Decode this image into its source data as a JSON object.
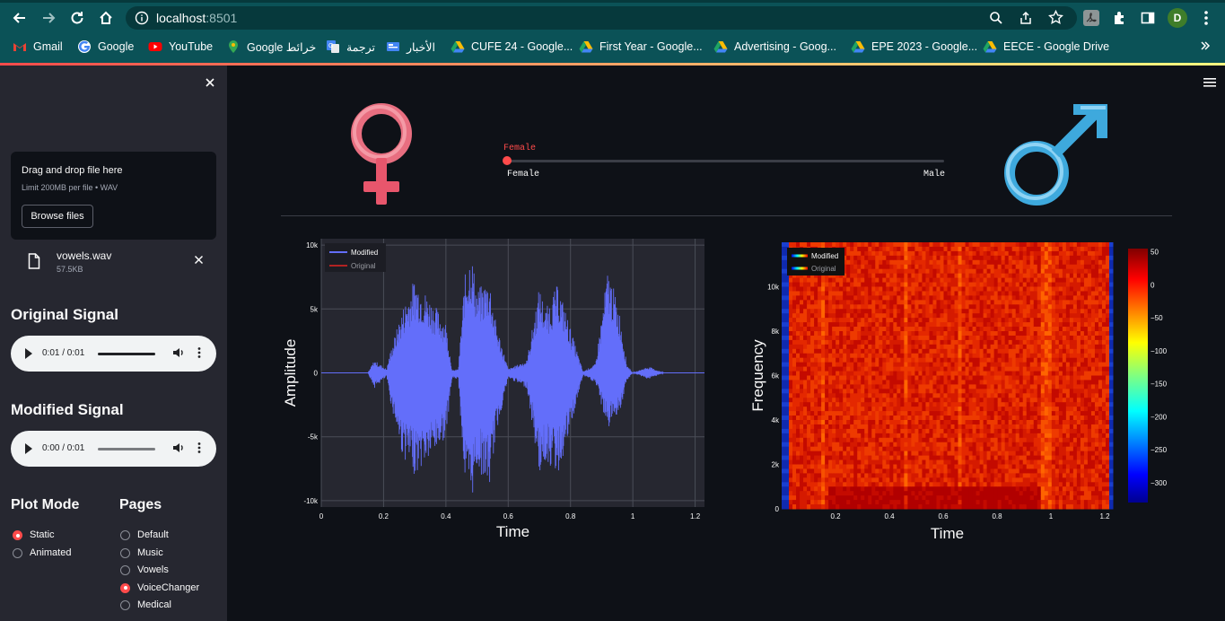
{
  "browser": {
    "url_host": "localhost",
    "url_port": ":8501",
    "bookmarks": [
      {
        "label": "Gmail",
        "icon": "gmail-icon",
        "color": "#ea4335"
      },
      {
        "label": "Google",
        "icon": "google-icon",
        "color": "#4285f4"
      },
      {
        "label": "YouTube",
        "icon": "youtube-icon",
        "color": "#ff0000"
      },
      {
        "label": "Google خرائط",
        "icon": "maps-icon",
        "color": "#34a853"
      },
      {
        "label": "ترجمة",
        "icon": "translate-icon",
        "color": "#4285f4"
      },
      {
        "label": "الأخبار",
        "icon": "news-icon",
        "color": "#4285f4"
      },
      {
        "label": "CUFE 24 - Google...",
        "icon": "drive-icon",
        "color": "#fbbc04"
      },
      {
        "label": "First Year  - Google...",
        "icon": "drive-icon",
        "color": "#fbbc04"
      },
      {
        "label": "Advertising  - Goog...",
        "icon": "drive-icon",
        "color": "#fbbc04"
      },
      {
        "label": "EPE 2023 - Google...",
        "icon": "drive-icon",
        "color": "#fbbc04"
      },
      {
        "label": "EECE - Google Drive",
        "icon": "drive-icon",
        "color": "#fbbc04"
      }
    ],
    "profile_initial": "D"
  },
  "sidebar": {
    "uploader": {
      "title": "Drag and drop file here",
      "limit": "Limit 200MB per file • WAV",
      "browse_label": "Browse files"
    },
    "file": {
      "name": "vowels.wav",
      "size": "57.5KB"
    },
    "original": {
      "heading": "Original Signal",
      "time": "0:01 / 0:01"
    },
    "modified": {
      "heading": "Modified Signal",
      "time": "0:00 / 0:01"
    },
    "plot_mode": {
      "heading": "Plot Mode",
      "options": [
        {
          "label": "Static",
          "selected": true
        },
        {
          "label": "Animated",
          "selected": false
        }
      ]
    },
    "pages": {
      "heading": "Pages",
      "options": [
        {
          "label": "Default",
          "selected": false
        },
        {
          "label": "Music",
          "selected": false
        },
        {
          "label": "Vowels",
          "selected": false
        },
        {
          "label": "VoiceChanger",
          "selected": true
        },
        {
          "label": "Medical",
          "selected": false
        }
      ]
    }
  },
  "voice_slider": {
    "current": "Female",
    "min_label": "Female",
    "max_label": "Male",
    "value": 0
  },
  "chart_data": [
    {
      "type": "line",
      "xlabel": "Time",
      "ylabel": "Amplitude",
      "xlim": [
        0,
        1.23
      ],
      "ylim": [
        -10500,
        10500
      ],
      "x_ticks": [
        "0",
        "0.2",
        "0.4",
        "0.6",
        "0.8",
        "1",
        "1.2"
      ],
      "y_ticks": [
        "10k",
        "5k",
        "0",
        "-5k",
        "-10k"
      ],
      "legend": [
        {
          "name": "Modified",
          "color": "#636efa"
        },
        {
          "name": "Original",
          "color": "#b22222"
        }
      ],
      "legend_position": "top-left",
      "series": [
        {
          "name": "Modified",
          "envelope_time": [
            0,
            0.15,
            0.17,
            0.21,
            0.22,
            0.26,
            0.3,
            0.36,
            0.4,
            0.42,
            0.44,
            0.46,
            0.48,
            0.5,
            0.54,
            0.56,
            0.6,
            0.66,
            0.7,
            0.72,
            0.76,
            0.8,
            0.84,
            0.88,
            0.92,
            0.94,
            0.96,
            0.98,
            1.0,
            1.05,
            1.1,
            1.23
          ],
          "envelope_pos": [
            0,
            0,
            1000,
            300,
            1500,
            5000,
            7500,
            5500,
            4000,
            200,
            300,
            7500,
            9800,
            6500,
            7500,
            4000,
            300,
            1000,
            6800,
            5000,
            7000,
            3500,
            100,
            700,
            8200,
            6500,
            4500,
            700,
            0,
            500,
            0,
            0
          ],
          "envelope_neg": [
            0,
            0,
            -1200,
            -300,
            -2000,
            -6500,
            -8000,
            -6500,
            -5000,
            -400,
            -500,
            -8500,
            -10400,
            -7500,
            -9000,
            -5000,
            -400,
            -1200,
            -8000,
            -7000,
            -8000,
            -4500,
            -200,
            -800,
            -4500,
            -3500,
            -3000,
            -700,
            0,
            -500,
            0,
            0
          ]
        }
      ]
    },
    {
      "type": "heatmap",
      "xlabel": "Time",
      "ylabel": "Frequency",
      "xlim": [
        0,
        1.23
      ],
      "ylim": [
        0,
        12000
      ],
      "x_ticks": [
        "0.2",
        "0.4",
        "0.6",
        "0.8",
        "1",
        "1.2"
      ],
      "y_ticks": [
        "10k",
        "8k",
        "6k",
        "4k",
        "2k",
        "0"
      ],
      "legend": [
        {
          "name": "Modified"
        },
        {
          "name": "Original"
        }
      ],
      "legend_position": "top-left",
      "colorscale": "jet",
      "colorbar_ticks": [
        "50",
        "0",
        "−50",
        "−100",
        "−150",
        "−200",
        "−250",
        "−300"
      ],
      "colorbar_range": [
        -330,
        55
      ]
    }
  ]
}
